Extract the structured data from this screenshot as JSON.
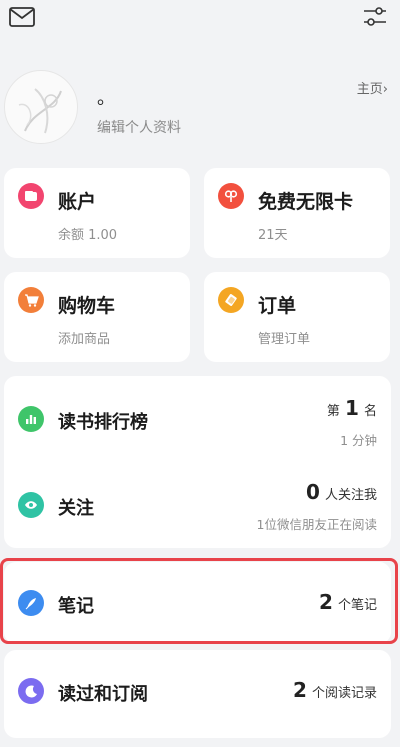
{
  "profile": {
    "nickname": "。",
    "edit_label": "编辑个人资料",
    "homepage_label": "主页›"
  },
  "grid": {
    "account": {
      "title": "账户",
      "subtitle": "余额 1.00"
    },
    "free_card": {
      "title": "免费无限卡",
      "subtitle": "21天"
    },
    "cart": {
      "title": "购物车",
      "subtitle": "添加商品"
    },
    "orders": {
      "title": "订单",
      "subtitle": "管理订单"
    }
  },
  "ranking": {
    "title": "读书排行榜",
    "rank_prefix": "第",
    "rank_value": "1",
    "rank_suffix": "名",
    "time": "1 分钟"
  },
  "follow": {
    "title": "关注",
    "count": "0",
    "count_suffix": "人关注我",
    "sub": "1位微信朋友正在阅读"
  },
  "notes": {
    "title": "笔记",
    "count": "2",
    "count_suffix": "个笔记"
  },
  "read": {
    "title": "读过和订阅",
    "count": "2",
    "count_suffix": "个阅读记录"
  },
  "colors": {
    "account": "#f2456f",
    "free_card": "#f2503e",
    "cart": "#f27f3a",
    "orders": "#f4a623",
    "ranking": "#3fc56a",
    "follow": "#2fc3a4",
    "notes": "#3d8cf0",
    "read": "#7b6cf0",
    "highlight": "#e8434a"
  }
}
